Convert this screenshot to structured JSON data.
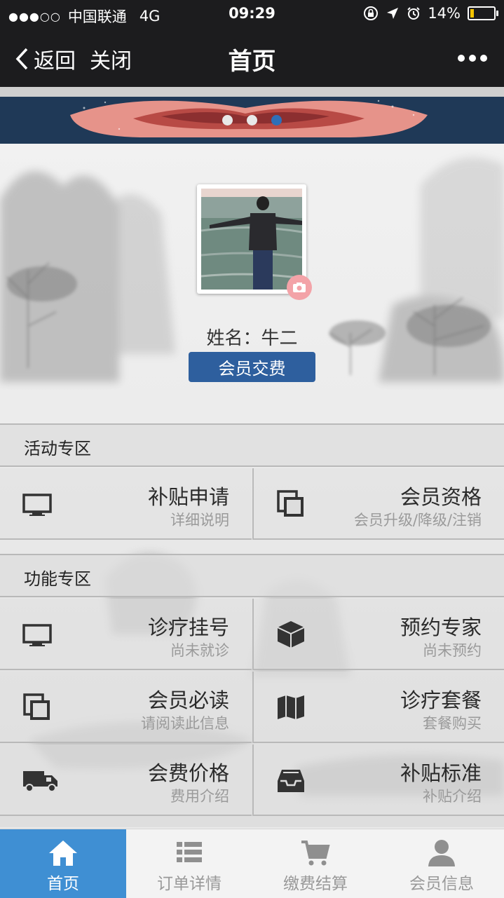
{
  "status_bar": {
    "signal": "●●●○○",
    "carrier": "中国联通",
    "network": "4G",
    "time": "09:29",
    "battery": "14%"
  },
  "nav": {
    "back_label": "返回",
    "close_label": "关闭",
    "title": "首页"
  },
  "banner": {
    "dots": [
      "#e8e8e8",
      "#e8e8e8",
      "#2e6fb8"
    ]
  },
  "profile": {
    "name_label": "姓名：牛二",
    "pay_button": "会员交费"
  },
  "sections": [
    {
      "title": "活动专区",
      "items": [
        {
          "title": "补贴申请",
          "subtitle": "详细说明",
          "icon": "monitor-icon"
        },
        {
          "title": "会员资格",
          "subtitle": "会员升级/降级/注销",
          "icon": "copy-icon"
        }
      ]
    },
    {
      "title": "功能专区",
      "items": [
        {
          "title": "诊疗挂号",
          "subtitle": "尚未就诊",
          "icon": "monitor-icon"
        },
        {
          "title": "预约专家",
          "subtitle": "尚未预约",
          "icon": "cube-icon"
        },
        {
          "title": "会员必读",
          "subtitle": "请阅读此信息",
          "icon": "copy-icon"
        },
        {
          "title": "诊疗套餐",
          "subtitle": "套餐购买",
          "icon": "map-icon"
        },
        {
          "title": "会费价格",
          "subtitle": "费用介绍",
          "icon": "truck-icon"
        },
        {
          "title": "补贴标准",
          "subtitle": "补贴介绍",
          "icon": "inbox-icon"
        }
      ]
    }
  ],
  "tabs": [
    {
      "label": "首页",
      "icon": "home-icon",
      "active": true
    },
    {
      "label": "订单详情",
      "icon": "list-icon",
      "active": false
    },
    {
      "label": "缴费结算",
      "icon": "cart-icon",
      "active": false
    },
    {
      "label": "会员信息",
      "icon": "user-icon",
      "active": false
    }
  ],
  "colors": {
    "nav_bg": "#1c1c1e",
    "accent": "#2e5f9e",
    "tab_active": "#3f8fd3",
    "camera_badge": "#f3a3a8"
  }
}
